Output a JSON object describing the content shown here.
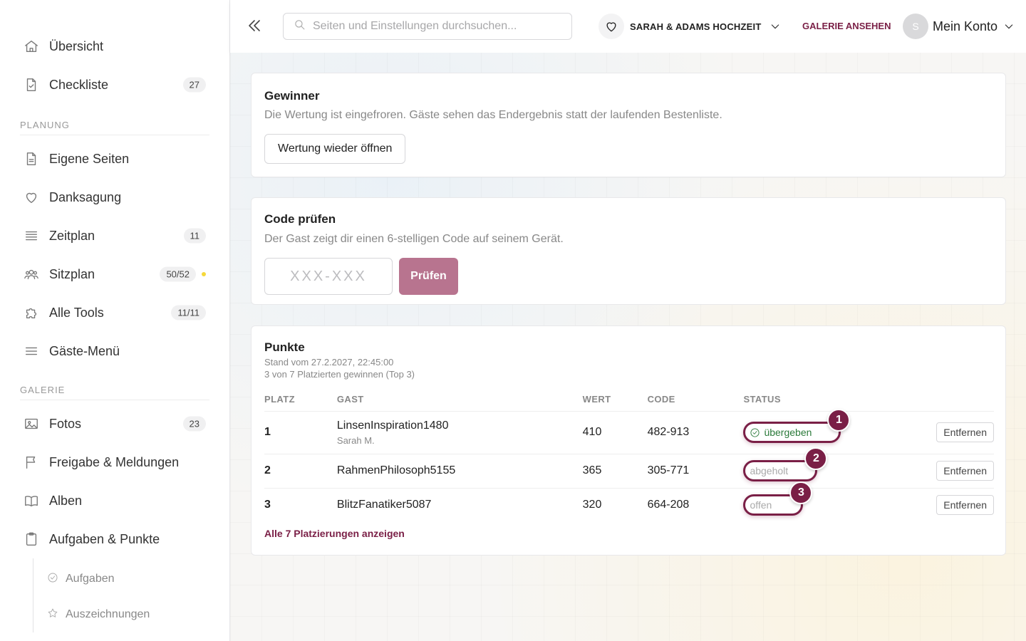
{
  "sidebar": {
    "top_items": [
      {
        "label": "Übersicht",
        "icon": "home-icon"
      },
      {
        "label": "Checkliste",
        "icon": "document-check-icon",
        "badge": "27"
      }
    ],
    "sections": [
      {
        "title": "PLANUNG",
        "items": [
          {
            "label": "Eigene Seiten",
            "icon": "page-icon"
          },
          {
            "label": "Danksagung",
            "icon": "heart-icon"
          },
          {
            "label": "Zeitplan",
            "icon": "list-icon",
            "badge": "11"
          },
          {
            "label": "Sitzplan",
            "icon": "people-icon",
            "badge": "50/52"
          },
          {
            "label": "Alle Tools",
            "icon": "puzzle-icon",
            "badge": "11/11"
          },
          {
            "label": "Gäste-Menü",
            "icon": "menu-icon"
          }
        ]
      },
      {
        "title": "GALERIE",
        "items": [
          {
            "label": "Fotos",
            "icon": "image-icon",
            "badge": "23"
          },
          {
            "label": "Freigabe & Meldungen",
            "icon": "flag-icon"
          },
          {
            "label": "Alben",
            "icon": "book-icon"
          },
          {
            "label": "Aufgaben & Punkte",
            "icon": "clipboard-icon"
          }
        ],
        "sub_items": [
          {
            "label": "Aufgaben",
            "icon": "check-circle-icon"
          },
          {
            "label": "Auszeichnungen",
            "icon": "star-icon"
          }
        ]
      }
    ]
  },
  "header": {
    "search_placeholder": "Seiten und Einstellungen durchsuchen...",
    "event_name": "SARAH & ADAMS HOCHZEIT",
    "gallery_link": "GALERIE ANSEHEN",
    "avatar_initial": "S",
    "account_label": "Mein Konto"
  },
  "winner_card": {
    "title": "Gewinner",
    "description": "Die Wertung ist eingefroren. Gäste sehen das Endergebnis statt der laufenden Bestenliste.",
    "button": "Wertung wieder öffnen"
  },
  "code_card": {
    "title": "Code prüfen",
    "description": "Der Gast zeigt dir einen 6-stelligen Code auf seinem Gerät.",
    "input_placeholder": "XXX-XXX",
    "button": "Prüfen"
  },
  "points_card": {
    "title": "Punkte",
    "timestamp": "Stand vom 27.2.2027, 22:45:00",
    "summary": "3 von 7 Platzierten gewinnen (Top 3)",
    "columns": [
      "PLATZ",
      "GAST",
      "WERT",
      "CODE",
      "STATUS"
    ],
    "rows": [
      {
        "place": "1",
        "guest": "LinsenInspiration1480",
        "guest_sub": "Sarah M.",
        "value": "410",
        "code": "482-913",
        "status": "übergeben",
        "marker": "1",
        "action": "Entfernen"
      },
      {
        "place": "2",
        "guest": "RahmenPhilosoph5155",
        "value": "365",
        "code": "305-771",
        "status": "abgeholt",
        "marker": "2",
        "action": "Entfernen"
      },
      {
        "place": "3",
        "guest": "BlitzFanatiker5087",
        "value": "320",
        "code": "664-208",
        "status": "offen",
        "marker": "3",
        "action": "Entfernen"
      }
    ],
    "show_all": "Alle 7 Platzierungen anzeigen"
  },
  "colors": {
    "accent": "#7a1f46",
    "primary_button": "#b8748f",
    "status_green": "#2b7a3a",
    "notification_dot": "#f5d83a"
  }
}
